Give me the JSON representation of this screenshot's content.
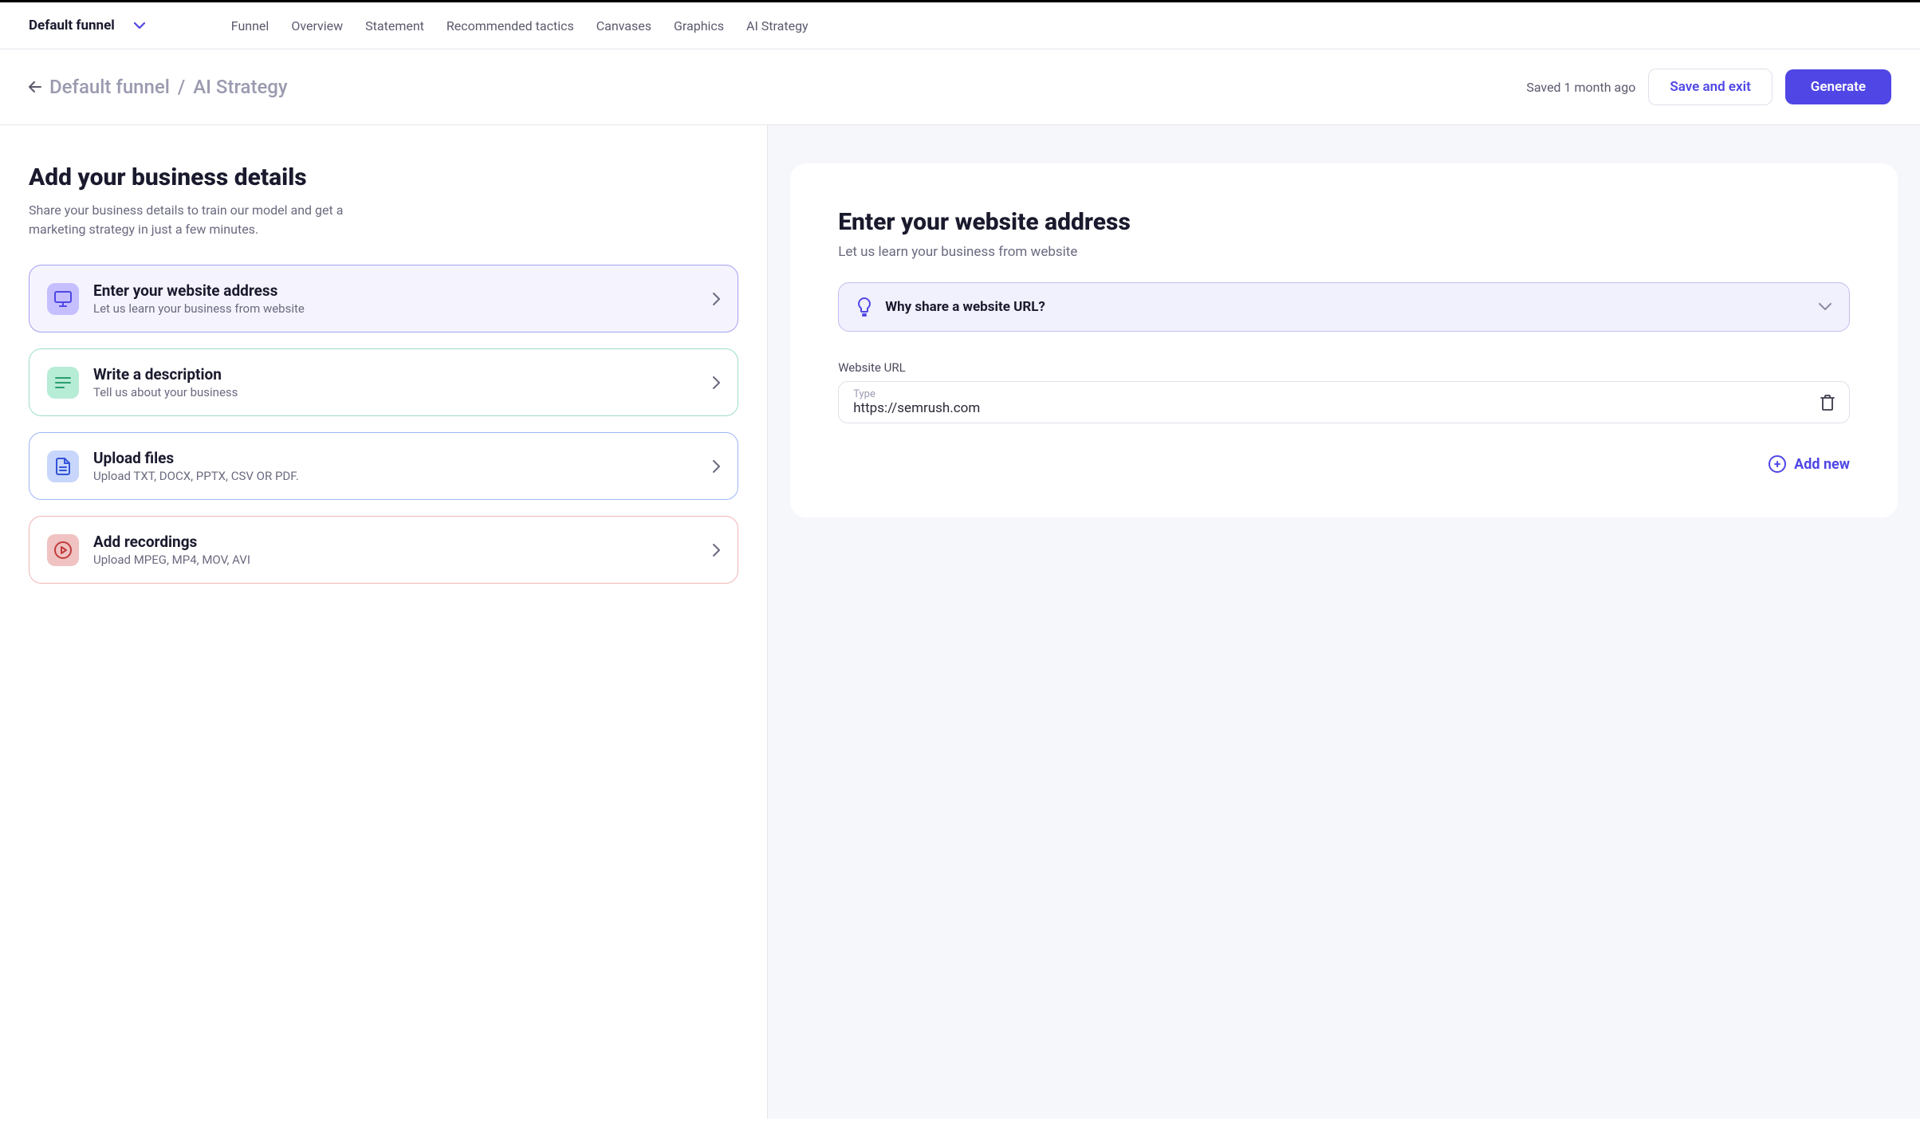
{
  "topbar": {
    "funnel_label": "Default funnel",
    "nav": [
      "Funnel",
      "Overview",
      "Statement",
      "Recommended tactics",
      "Canvases",
      "Graphics",
      "AI Strategy"
    ]
  },
  "header": {
    "breadcrumb_funnel": "Default funnel",
    "breadcrumb_sep": "/",
    "breadcrumb_page": "AI Strategy",
    "saved_text": "Saved 1 month ago",
    "save_exit": "Save and exit",
    "generate": "Generate"
  },
  "left": {
    "title": "Add your business details",
    "subtitle": "Share your business details to train our model and get a marketing strategy in just a few minutes.",
    "options": [
      {
        "title": "Enter your website address",
        "desc": "Let us learn your business from website"
      },
      {
        "title": "Write a description",
        "desc": "Tell us about your business"
      },
      {
        "title": "Upload files",
        "desc": "Upload TXT, DOCX, PPTX, CSV OR PDF."
      },
      {
        "title": "Add recordings",
        "desc": "Upload MPEG, MP4, MOV, AVI"
      }
    ]
  },
  "right": {
    "title": "Enter your website address",
    "subtitle": "Let us learn your business from website",
    "banner_text": "Why share a website URL?",
    "field_label": "Website URL",
    "placeholder_label": "Type",
    "url_value": "https://semrush.com",
    "add_new": "Add new"
  }
}
